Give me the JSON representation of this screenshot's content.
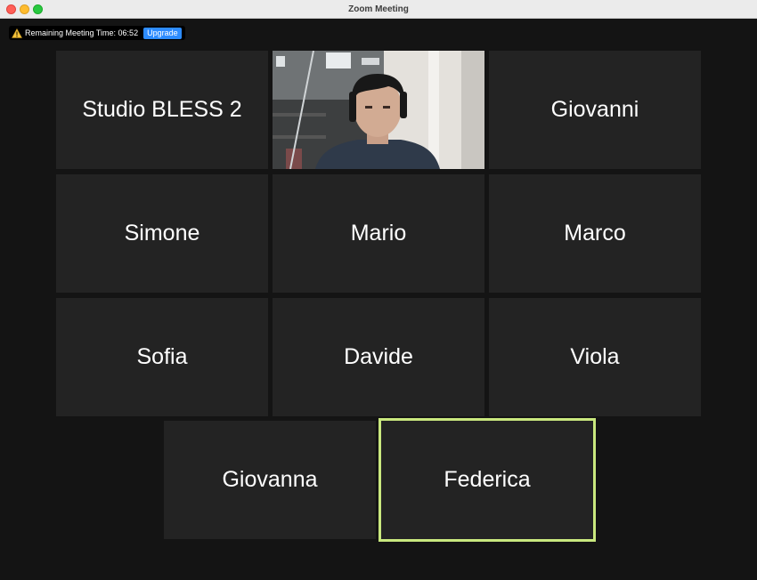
{
  "window": {
    "title": "Zoom Meeting"
  },
  "banner": {
    "timer_text": "Remaining Meeting Time: 06:52",
    "upgrade_label": "Upgrade"
  },
  "participants": {
    "studio": "Studio BLESS 2",
    "giovanni": "Giovanni",
    "simone": "Simone",
    "mario": "Mario",
    "marco": "Marco",
    "sofia": "Sofia",
    "davide": "Davide",
    "viola": "Viola",
    "giovanna": "Giovanna",
    "federica": "Federica"
  },
  "colors": {
    "active_speaker_border": "#c9e87e",
    "upgrade_button": "#2d8cff",
    "tile_background": "#232323"
  }
}
